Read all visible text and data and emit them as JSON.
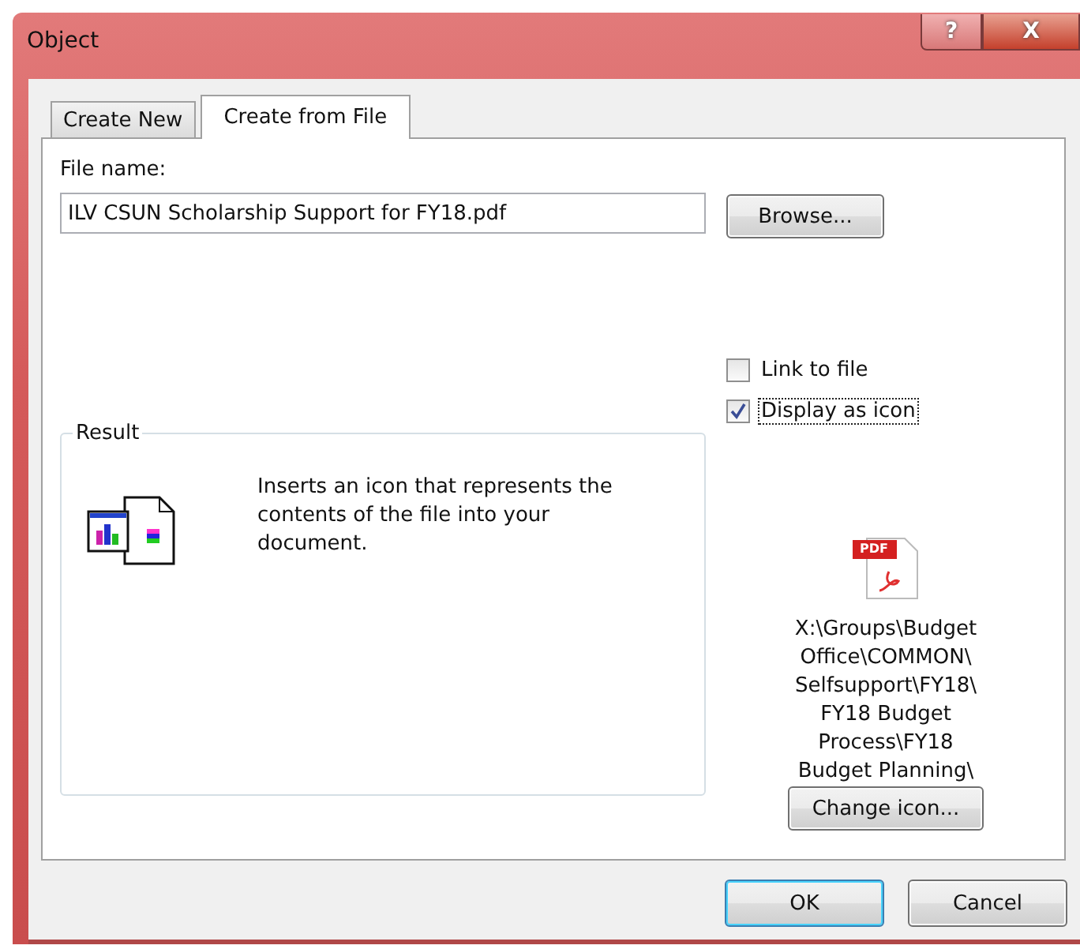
{
  "window": {
    "title": "Object",
    "title_buttons": [
      {
        "label": "?",
        "kind": "help"
      },
      {
        "label": "X",
        "kind": "close"
      }
    ]
  },
  "tabs": [
    {
      "label": "Create New",
      "selected": false
    },
    {
      "label": "Create from File",
      "selected": true
    }
  ],
  "file_name": {
    "label": "File name:",
    "value": "ILV CSUN Scholarship Support for FY18.pdf"
  },
  "browse_button": "Browse...",
  "options": [
    {
      "label": "Link to file",
      "checked": false,
      "focused": false
    },
    {
      "label": "Display as icon",
      "checked": true,
      "focused": true
    }
  ],
  "result": {
    "title": "Result",
    "description": "Inserts an icon that represents the contents of the file into your document."
  },
  "icon_preview": {
    "badge": "PDF",
    "caption_lines": [
      "X:\\Groups\\Budget",
      "Office\\COMMON\\",
      "Selfsupport\\FY18\\",
      "FY18 Budget",
      "Process\\FY18",
      "Budget Planning\\"
    ]
  },
  "change_icon_button": "Change icon...",
  "buttons": [
    {
      "label": "OK",
      "kind": "default"
    },
    {
      "label": "Cancel",
      "kind": "normal"
    }
  ]
}
